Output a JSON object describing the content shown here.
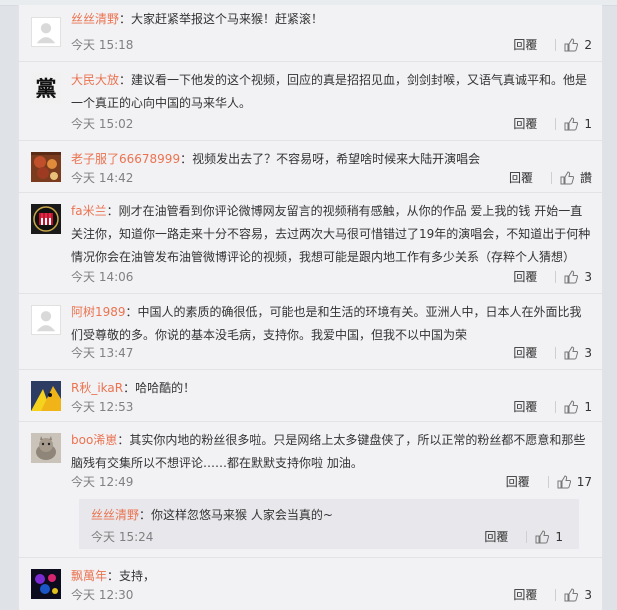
{
  "comments": [
    {
      "name": "丝丝清野",
      "text": "：大家赶紧举报这个马来猴！赶紧滚！",
      "time": "今天 15:18",
      "reply": "回覆",
      "likes": "2"
    },
    {
      "name": "大民大放",
      "text": "：建议看一下他发的这个视频，回应的真是招招见血，剑剑封喉，又语气真诚平和。他是一个真正的心向中国的马来华人。",
      "time": "今天 15:02",
      "reply": "回覆",
      "likes": "1"
    },
    {
      "name": "老子服了66678999",
      "text": "：视频发出去了？不容易呀，希望啥时候来大陆开演唱会",
      "time": "今天 14:42",
      "reply": "回覆",
      "likes": "讚"
    },
    {
      "name": "fa米兰",
      "text": "：刚才在油管看到你评论微博网友留言的视频稍有感触，从你的作品 爱上我的钱 开始一直关注你，知道你一路走来十分不容易，去过两次大马很可惜错过了19年的演唱会，不知道出于何种情况你会在油管发布油管微博评论的视频，我想可能是跟内地工作有多少关系（存粹个人猜想）",
      "time": "今天 14:06",
      "reply": "回覆",
      "likes": "3"
    },
    {
      "name": "阿树1989",
      "text": "：中国人的素质的确很低，可能也是和生活的环境有关。亚洲人中，日本人在外面比我们受尊敬的多。你说的基本没毛病，支持你。我爱中国，但我不以中国为荣",
      "time": "今天 13:47",
      "reply": "回覆",
      "likes": "3"
    },
    {
      "name": "R秋_ikaR",
      "text": "：哈哈酷的！",
      "time": "今天 12:53",
      "reply": "回覆",
      "likes": "1"
    },
    {
      "name": "boo浠崽",
      "text": "：其实你内地的粉丝很多啦。只是网络上太多键盘侠了，所以正常的粉丝都不愿意和那些脑残有交集所以不想评论……都在默默支持你啦 加油。",
      "time": "今天 12:49",
      "reply": "回覆",
      "likes": "17",
      "sub": {
        "name": "丝丝清野",
        "text": "：你这样忽悠马来猴 人家会当真的~",
        "time": "今天 15:24",
        "reply": "回覆",
        "likes": "1"
      }
    },
    {
      "name": "飘萬年",
      "text": "：支持，",
      "time": "今天 12:30",
      "reply": "回覆",
      "likes": "3"
    }
  ],
  "avatars": [
    "default-avatar",
    "dang-character-avatar",
    "food-photo-avatar",
    "ac-milan-logo-avatar",
    "default-avatar",
    "yellow-cartoon-avatar",
    "cat-photo-avatar",
    "dark-colorful-avatar"
  ]
}
